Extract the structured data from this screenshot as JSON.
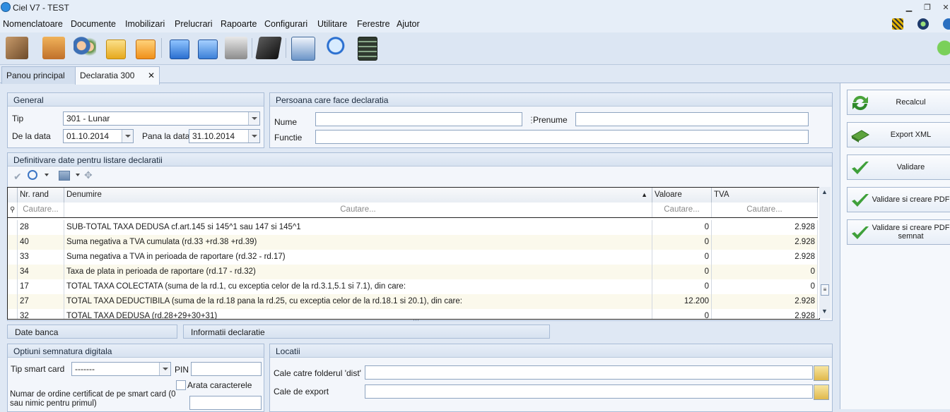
{
  "window": {
    "title": "Ciel V7 - TEST",
    "controls": {
      "minimize": "▁",
      "restore": "❐",
      "close": "✕"
    }
  },
  "menu": [
    "Nomenclatoare",
    "Documente",
    "Imobilizari",
    "Prelucrari",
    "Rapoarte",
    "Configurari",
    "Utilitare",
    "Ferestre",
    "Ajutor"
  ],
  "toolbar_icons": [
    "handshake-icon",
    "box-icon",
    "users-icon",
    "download-icon",
    "transfer-icon",
    "upload-icon",
    "sync-icon",
    "cash-register-icon",
    "book-icon",
    "print-icon",
    "magnifier-icon",
    "calculator-icon"
  ],
  "tabs": [
    {
      "label": "Panou principal",
      "active": false
    },
    {
      "label": "Declaratia 300",
      "active": true,
      "close": "✕"
    }
  ],
  "general": {
    "title": "General",
    "tip_label": "Tip",
    "tip_value": "301 - Lunar",
    "de_la_label": "De la data",
    "de_la_value": "01.10.2014",
    "pana_la_label": "Pana la data",
    "pana_la_value": "31.10.2014"
  },
  "persoana": {
    "title": "Persoana care face declaratia",
    "nume_label": "Nume",
    "nume_value": "",
    "prenume_label": "Prenume",
    "prenume_value": "",
    "functie_label": "Functie",
    "functie_value": ""
  },
  "definitivare": {
    "title": "Definitivare date pentru listare declaratii",
    "columns": {
      "nr": "Nr. rand",
      "den": "Denumire",
      "val": "Valoare",
      "tva": "TVA"
    },
    "filter_placeholder": "Cautare...",
    "rows": [
      {
        "nr": "28",
        "den": "SUB-TOTAL TAXA DEDUSA cf.art.145 si 145^1 sau 147 si 145^1",
        "val": "0",
        "tva": "2.928"
      },
      {
        "nr": "40",
        "den": "Suma negativa a TVA cumulata (rd.33 +rd.38 +rd.39)",
        "val": "0",
        "tva": "2.928"
      },
      {
        "nr": "33",
        "den": "Suma negativa a TVA in perioada de raportare (rd.32 - rd.17)",
        "val": "0",
        "tva": "2.928"
      },
      {
        "nr": "34",
        "den": "Taxa de plata in perioada de raportare (rd.17 - rd.32)",
        "val": "0",
        "tva": "0"
      },
      {
        "nr": "17",
        "den": "TOTAL TAXA COLECTATA (suma de la rd.1, cu exceptia celor de la rd.3.1,5.1 si 7.1), din care:",
        "val": "0",
        "tva": "0"
      },
      {
        "nr": "27",
        "den": "TOTAL TAXA DEDUCTIBILA (suma de la rd.18 pana la rd.25, cu exceptia celor de la rd.18.1 si 20.1), din care:",
        "val": "12.200",
        "tva": "2.928"
      },
      {
        "nr": "32",
        "den": "TOTAL TAXA DEDUSA (rd.28+29+30+31)",
        "val": "0",
        "tva": "2.928"
      }
    ]
  },
  "subtabs": {
    "banca": "Date banca",
    "informatii": "Informatii declaratie"
  },
  "semnatura": {
    "title": "Optiuni semnatura digitala",
    "tip_label": "Tip smart card",
    "tip_value": "-------",
    "pin_label": "PIN",
    "arata_label": "Arata caracterele",
    "numar_label": "Numar de ordine certificat de pe smart card (0 sau nimic pentru primul)"
  },
  "locatii": {
    "title": "Locatii",
    "dist_label": "Cale catre folderul 'dist'",
    "export_label": "Cale de export"
  },
  "actions": {
    "recalcul": "Recalcul",
    "export_xml": "Export XML",
    "validare": "Validare",
    "validare_pdf": "Validare si creare PDF",
    "validare_pdf_semnat": "Validare si creare PDF semnat"
  },
  "colors": {
    "accent": "#2f8de0",
    "grid_alt_row": "#fbf9ec",
    "panel_border": "#a9bcd6"
  }
}
